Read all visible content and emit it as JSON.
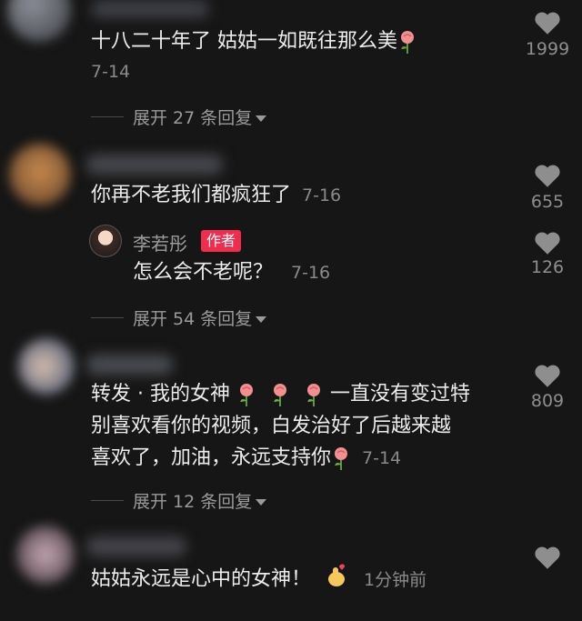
{
  "comments": [
    {
      "text": "十八二十年了 姑姑一如既往那么美",
      "date": "7-14",
      "likes": "1999",
      "expand": "展开 27 条回复"
    },
    {
      "text": "你再不老我们都疯狂了",
      "date": "7-16",
      "likes": "655",
      "reply": {
        "author": "李若彤",
        "badge": "作者",
        "text": "怎么会不老呢？",
        "date": "7-16",
        "likes": "126"
      },
      "expand": "展开 54 条回复"
    },
    {
      "line1_a": "转发 · 我的女神",
      "line1_b": "一直没有变过特",
      "line2": "别喜欢看你的视频，白发治好了后越来越",
      "line3": "喜欢了，加油，永远支持你",
      "date": "7-14",
      "likes": "809",
      "expand": "展开 12 条回复"
    },
    {
      "text": "姑姑永远是心中的女神！",
      "date": "1分钟前"
    }
  ],
  "icons": {
    "like": "heart-icon",
    "emoji_rose": "rose-emoji-icon",
    "emoji_finger_heart": "finger-heart-emoji-icon"
  },
  "colors": {
    "background": "#161616",
    "author_badge": "#f02c4f"
  }
}
